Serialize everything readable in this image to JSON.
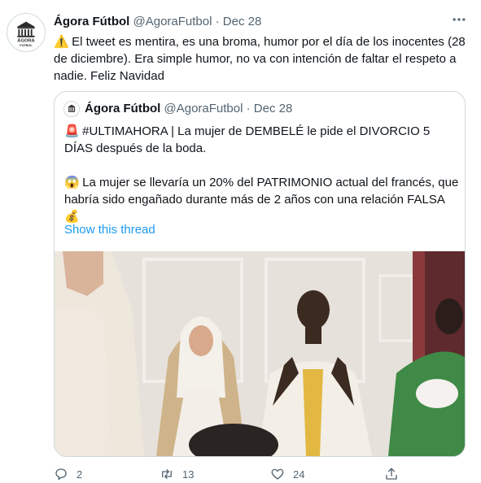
{
  "tweet": {
    "author_name": "Ágora Fútbol",
    "handle": "@AgoraFutbol",
    "separator": "·",
    "date": "Dec 28",
    "more_icon": "more-dots-icon",
    "warning_emoji": "⚠️",
    "text": "El tweet es mentira, es una broma, humor por el día de los inocentes (28 de diciembre). Era simple humor, no va con intención de faltar el respeto a nadie. Feliz Navidad",
    "avatar_text": [
      "ÁGORA",
      "FÚTBOL"
    ]
  },
  "quoted": {
    "author_name": "Ágora Fútbol",
    "handle": "@AgoraFutbol",
    "separator": "·",
    "date": "Dec 28",
    "line1_emoji": "🚨",
    "line1": "#ULTIMAHORA | La mujer de DEMBELÉ le pide el DIVORCIO 5 DÍAS después de la boda.",
    "line2_emoji": "😱",
    "line2": "La mujer se llevaría un 20% del PATRIMONIO actual del francés, que habría sido engañado durante más de 2 años con una relación FALSA",
    "line3_emoji": "💰",
    "show_thread": "Show this thread"
  },
  "actions": {
    "reply_count": "2",
    "retweet_count": "13",
    "like_count": "24",
    "icons": [
      "reply-icon",
      "retweet-icon",
      "like-icon",
      "share-icon"
    ]
  },
  "colors": {
    "text": "#0f1419",
    "muted": "#536471",
    "link": "#1d9bf0",
    "border": "#cfd9de"
  }
}
